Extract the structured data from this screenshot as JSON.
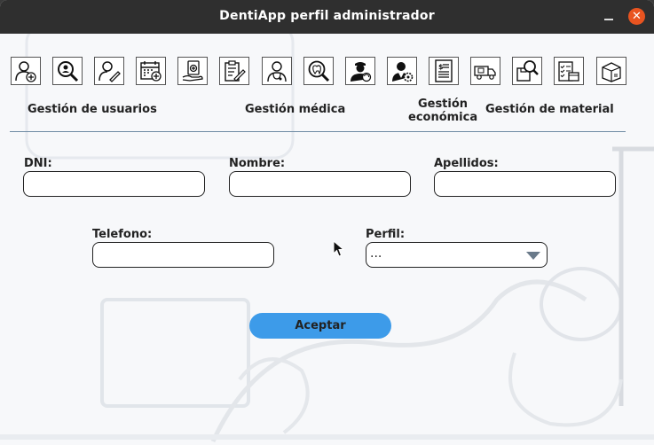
{
  "window": {
    "title": "DentiApp perfil administrador"
  },
  "titlebar": {
    "minimize_glyph": "_",
    "close_glyph": "✕"
  },
  "toolbar": {
    "buttons": [
      {
        "icon": "add-user-icon"
      },
      {
        "icon": "search-user-icon"
      },
      {
        "icon": "edit-user-icon"
      },
      {
        "icon": "calendar-add-icon"
      },
      {
        "icon": "medical-kit-icon"
      },
      {
        "icon": "clipboard-edit-icon"
      },
      {
        "icon": "doctor-icon"
      },
      {
        "icon": "search-tooth-icon"
      },
      {
        "icon": "staff-refresh-icon"
      },
      {
        "icon": "staff-settings-icon"
      },
      {
        "icon": "invoice-icon"
      },
      {
        "icon": "delivery-truck-icon"
      },
      {
        "icon": "search-box-icon"
      },
      {
        "icon": "inventory-checklist-icon"
      },
      {
        "icon": "package-icon"
      }
    ]
  },
  "categories": {
    "usuarios": "Gestión de usuarios",
    "medica": "Gestión médica",
    "economica_line1": "Gestión",
    "economica_line2": "económica",
    "material": "Gestión de material"
  },
  "form": {
    "dni_label": "DNI:",
    "dni_value": "",
    "nombre_label": "Nombre:",
    "nombre_value": "",
    "apellidos_label": "Apellidos:",
    "apellidos_value": "",
    "telefono_label": "Telefono:",
    "telefono_value": "",
    "perfil_label": "Perfil:",
    "perfil_selected": "..."
  },
  "actions": {
    "accept_label": "Aceptar"
  },
  "colors": {
    "accent": "#3d9be9",
    "titlebar": "#2f2f2f",
    "close": "#e95420",
    "divider": "#6f8ba3"
  }
}
